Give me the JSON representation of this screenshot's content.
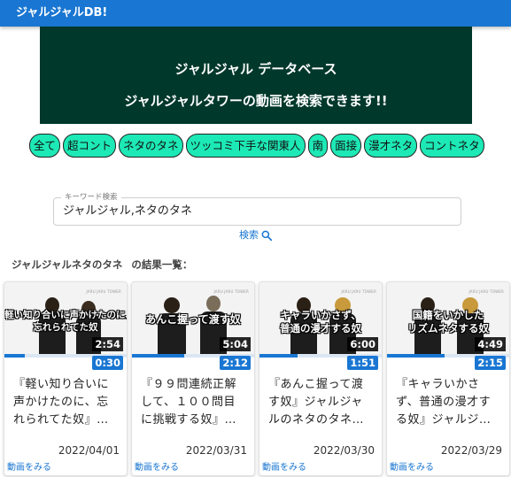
{
  "appbar": {
    "title": "ジャルジャルDB!"
  },
  "banner": {
    "line1": "ジャルジャル データベース",
    "line2": "ジャルジャルタワーの動画を検索できます!!"
  },
  "categories": [
    "全て",
    "超コント",
    "ネタのタネ",
    "ツッコミ下手な関東人",
    "南",
    "面接",
    "漫才ネタ",
    "コントネタ"
  ],
  "search": {
    "legend": "キーワード検索",
    "value": "ジャルジャル,ネタのタネ",
    "button_label": "検索"
  },
  "results": {
    "query_label": "ジャルジャルネタのタネ",
    "suffix": "の結果一覧："
  },
  "videos": [
    {
      "caption": "軽い知り合いに声かけたのに、忘れられてた奴",
      "caption_lines": [
        "軽い知り合いに声かけたのに、",
        "忘れられてた奴"
      ],
      "duration": "2:54",
      "progress_label": "0:30",
      "progress": 0.17,
      "title": "『軽い知り合いに声かけたのに、忘れられてた奴』…",
      "date": "2022/04/01",
      "link": "動画をみる"
    },
    {
      "caption": "あんこ握って渡す奴",
      "caption_lines": [
        "あんこ握って渡す奴"
      ],
      "duration": "5:04",
      "progress_label": "2:12",
      "progress": 0.43,
      "title": "『９９問連続正解して、１００問目に挑戦する奴』…",
      "date": "2022/03/31",
      "link": "動画をみる"
    },
    {
      "caption": "キャラいかさず、普通の漫才する奴",
      "caption_lines": [
        "キャラいかさず、",
        "普通の漫才する奴"
      ],
      "duration": "6:00",
      "progress_label": "1:51",
      "progress": 0.31,
      "title": "『あんこ握って渡す奴』ジャルジャルのネタのタネ…",
      "date": "2022/03/30",
      "link": "動画をみる"
    },
    {
      "caption": "国籍をいかしたリズムネタする奴",
      "caption_lines": [
        "国籍をいかした",
        "リズムネタする奴"
      ],
      "duration": "4:49",
      "progress_label": "2:15",
      "progress": 0.47,
      "title": "『キャラいかさず、普通の漫才する奴』ジャルジ…",
      "date": "2022/03/29",
      "link": "動画をみる"
    }
  ],
  "colors": {
    "appbar": "#1976d2",
    "banner": "#00382b",
    "chip": "#1de9b6",
    "link": "#1976d2"
  },
  "icons": {
    "search": "search-icon"
  }
}
